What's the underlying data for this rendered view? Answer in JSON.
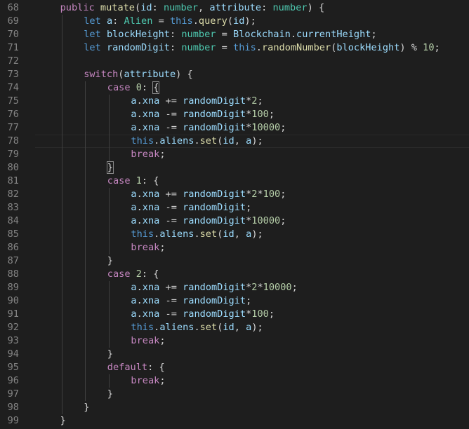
{
  "editor": {
    "theme": {
      "background": "#1e1e1e",
      "line_number": "#858585",
      "keyword": "#c586c0",
      "this": "#569cd6",
      "function": "#dcdcaa",
      "variable": "#9cdcfe",
      "type": "#4ec9b0",
      "number": "#b5cea8",
      "plain": "#d4d4d4"
    },
    "current_line": "78",
    "lines": [
      {
        "num": "68",
        "indent": 1,
        "tokens": [
          [
            "kw",
            "public"
          ],
          [
            "plain",
            " "
          ],
          [
            "fn",
            "mutate"
          ],
          [
            "plain",
            "("
          ],
          [
            "var",
            "id"
          ],
          [
            "plain",
            ": "
          ],
          [
            "type",
            "number"
          ],
          [
            "plain",
            ", "
          ],
          [
            "var",
            "attribute"
          ],
          [
            "plain",
            ": "
          ],
          [
            "type",
            "number"
          ],
          [
            "plain",
            ") {"
          ]
        ]
      },
      {
        "num": "69",
        "indent": 2,
        "tokens": [
          [
            "this",
            "let"
          ],
          [
            "plain",
            " "
          ],
          [
            "var",
            "a"
          ],
          [
            "plain",
            ": "
          ],
          [
            "type",
            "Alien"
          ],
          [
            "plain",
            " = "
          ],
          [
            "this",
            "this"
          ],
          [
            "plain",
            "."
          ],
          [
            "fn",
            "query"
          ],
          [
            "plain",
            "("
          ],
          [
            "var",
            "id"
          ],
          [
            "plain",
            ");"
          ]
        ]
      },
      {
        "num": "70",
        "indent": 2,
        "tokens": [
          [
            "this",
            "let"
          ],
          [
            "plain",
            " "
          ],
          [
            "var",
            "blockHeight"
          ],
          [
            "plain",
            ": "
          ],
          [
            "type",
            "number"
          ],
          [
            "plain",
            " = "
          ],
          [
            "var",
            "Blockchain"
          ],
          [
            "plain",
            "."
          ],
          [
            "var",
            "currentHeight"
          ],
          [
            "plain",
            ";"
          ]
        ]
      },
      {
        "num": "71",
        "indent": 2,
        "tokens": [
          [
            "this",
            "let"
          ],
          [
            "plain",
            " "
          ],
          [
            "var",
            "randomDigit"
          ],
          [
            "plain",
            ": "
          ],
          [
            "type",
            "number"
          ],
          [
            "plain",
            " = "
          ],
          [
            "this",
            "this"
          ],
          [
            "plain",
            "."
          ],
          [
            "fn",
            "randomNumber"
          ],
          [
            "plain",
            "("
          ],
          [
            "var",
            "blockHeight"
          ],
          [
            "plain",
            ") % "
          ],
          [
            "num",
            "10"
          ],
          [
            "plain",
            ";"
          ]
        ]
      },
      {
        "num": "72",
        "indent": 0,
        "tokens": []
      },
      {
        "num": "73",
        "indent": 2,
        "tokens": [
          [
            "kw",
            "switch"
          ],
          [
            "plain",
            "("
          ],
          [
            "var",
            "attribute"
          ],
          [
            "plain",
            ") {"
          ]
        ]
      },
      {
        "num": "74",
        "indent": 3,
        "tokens": [
          [
            "kw",
            "case"
          ],
          [
            "plain",
            " "
          ],
          [
            "num",
            "0"
          ],
          [
            "plain",
            ": "
          ],
          [
            "hl",
            "{"
          ]
        ]
      },
      {
        "num": "75",
        "indent": 4,
        "tokens": [
          [
            "var",
            "a"
          ],
          [
            "plain",
            "."
          ],
          [
            "var",
            "xna"
          ],
          [
            "plain",
            " += "
          ],
          [
            "var",
            "randomDigit"
          ],
          [
            "plain",
            "*"
          ],
          [
            "num",
            "2"
          ],
          [
            "plain",
            ";"
          ]
        ]
      },
      {
        "num": "76",
        "indent": 4,
        "tokens": [
          [
            "var",
            "a"
          ],
          [
            "plain",
            "."
          ],
          [
            "var",
            "xna"
          ],
          [
            "plain",
            " -= "
          ],
          [
            "var",
            "randomDigit"
          ],
          [
            "plain",
            "*"
          ],
          [
            "num",
            "100"
          ],
          [
            "plain",
            ";"
          ]
        ]
      },
      {
        "num": "77",
        "indent": 4,
        "tokens": [
          [
            "var",
            "a"
          ],
          [
            "plain",
            "."
          ],
          [
            "var",
            "xna"
          ],
          [
            "plain",
            " -= "
          ],
          [
            "var",
            "randomDigit"
          ],
          [
            "plain",
            "*"
          ],
          [
            "num",
            "10000"
          ],
          [
            "plain",
            ";"
          ]
        ]
      },
      {
        "num": "78",
        "indent": 4,
        "tokens": [
          [
            "this",
            "this"
          ],
          [
            "plain",
            "."
          ],
          [
            "var",
            "aliens"
          ],
          [
            "plain",
            "."
          ],
          [
            "fn",
            "set"
          ],
          [
            "plain",
            "("
          ],
          [
            "var",
            "id"
          ],
          [
            "plain",
            ", "
          ],
          [
            "var",
            "a"
          ],
          [
            "plain",
            ");"
          ]
        ]
      },
      {
        "num": "79",
        "indent": 4,
        "tokens": [
          [
            "kw",
            "break"
          ],
          [
            "plain",
            ";"
          ]
        ]
      },
      {
        "num": "80",
        "indent": 3,
        "tokens": [
          [
            "hl",
            "}"
          ]
        ]
      },
      {
        "num": "81",
        "indent": 3,
        "tokens": [
          [
            "kw",
            "case"
          ],
          [
            "plain",
            " "
          ],
          [
            "num",
            "1"
          ],
          [
            "plain",
            ": {"
          ]
        ]
      },
      {
        "num": "82",
        "indent": 4,
        "tokens": [
          [
            "var",
            "a"
          ],
          [
            "plain",
            "."
          ],
          [
            "var",
            "xna"
          ],
          [
            "plain",
            " += "
          ],
          [
            "var",
            "randomDigit"
          ],
          [
            "plain",
            "*"
          ],
          [
            "num",
            "2"
          ],
          [
            "plain",
            "*"
          ],
          [
            "num",
            "100"
          ],
          [
            "plain",
            ";"
          ]
        ]
      },
      {
        "num": "83",
        "indent": 4,
        "tokens": [
          [
            "var",
            "a"
          ],
          [
            "plain",
            "."
          ],
          [
            "var",
            "xna"
          ],
          [
            "plain",
            " -= "
          ],
          [
            "var",
            "randomDigit"
          ],
          [
            "plain",
            ";"
          ]
        ]
      },
      {
        "num": "84",
        "indent": 4,
        "tokens": [
          [
            "var",
            "a"
          ],
          [
            "plain",
            "."
          ],
          [
            "var",
            "xna"
          ],
          [
            "plain",
            " -= "
          ],
          [
            "var",
            "randomDigit"
          ],
          [
            "plain",
            "*"
          ],
          [
            "num",
            "10000"
          ],
          [
            "plain",
            ";"
          ]
        ]
      },
      {
        "num": "85",
        "indent": 4,
        "tokens": [
          [
            "this",
            "this"
          ],
          [
            "plain",
            "."
          ],
          [
            "var",
            "aliens"
          ],
          [
            "plain",
            "."
          ],
          [
            "fn",
            "set"
          ],
          [
            "plain",
            "("
          ],
          [
            "var",
            "id"
          ],
          [
            "plain",
            ", "
          ],
          [
            "var",
            "a"
          ],
          [
            "plain",
            ");"
          ]
        ]
      },
      {
        "num": "86",
        "indent": 4,
        "tokens": [
          [
            "kw",
            "break"
          ],
          [
            "plain",
            ";"
          ]
        ]
      },
      {
        "num": "87",
        "indent": 3,
        "tokens": [
          [
            "plain",
            "}"
          ]
        ]
      },
      {
        "num": "88",
        "indent": 3,
        "tokens": [
          [
            "kw",
            "case"
          ],
          [
            "plain",
            " "
          ],
          [
            "num",
            "2"
          ],
          [
            "plain",
            ": {"
          ]
        ]
      },
      {
        "num": "89",
        "indent": 4,
        "tokens": [
          [
            "var",
            "a"
          ],
          [
            "plain",
            "."
          ],
          [
            "var",
            "xna"
          ],
          [
            "plain",
            " += "
          ],
          [
            "var",
            "randomDigit"
          ],
          [
            "plain",
            "*"
          ],
          [
            "num",
            "2"
          ],
          [
            "plain",
            "*"
          ],
          [
            "num",
            "10000"
          ],
          [
            "plain",
            ";"
          ]
        ]
      },
      {
        "num": "90",
        "indent": 4,
        "tokens": [
          [
            "var",
            "a"
          ],
          [
            "plain",
            "."
          ],
          [
            "var",
            "xna"
          ],
          [
            "plain",
            " -= "
          ],
          [
            "var",
            "randomDigit"
          ],
          [
            "plain",
            ";"
          ]
        ]
      },
      {
        "num": "91",
        "indent": 4,
        "tokens": [
          [
            "var",
            "a"
          ],
          [
            "plain",
            "."
          ],
          [
            "var",
            "xna"
          ],
          [
            "plain",
            " -= "
          ],
          [
            "var",
            "randomDigit"
          ],
          [
            "plain",
            "*"
          ],
          [
            "num",
            "100"
          ],
          [
            "plain",
            ";"
          ]
        ]
      },
      {
        "num": "92",
        "indent": 4,
        "tokens": [
          [
            "this",
            "this"
          ],
          [
            "plain",
            "."
          ],
          [
            "var",
            "aliens"
          ],
          [
            "plain",
            "."
          ],
          [
            "fn",
            "set"
          ],
          [
            "plain",
            "("
          ],
          [
            "var",
            "id"
          ],
          [
            "plain",
            ", "
          ],
          [
            "var",
            "a"
          ],
          [
            "plain",
            ");"
          ]
        ]
      },
      {
        "num": "93",
        "indent": 4,
        "tokens": [
          [
            "kw",
            "break"
          ],
          [
            "plain",
            ";"
          ]
        ]
      },
      {
        "num": "94",
        "indent": 3,
        "tokens": [
          [
            "plain",
            "}"
          ]
        ]
      },
      {
        "num": "95",
        "indent": 3,
        "tokens": [
          [
            "kw",
            "default"
          ],
          [
            "plain",
            ": {"
          ]
        ]
      },
      {
        "num": "96",
        "indent": 4,
        "tokens": [
          [
            "kw",
            "break"
          ],
          [
            "plain",
            ";"
          ]
        ]
      },
      {
        "num": "97",
        "indent": 3,
        "tokens": [
          [
            "plain",
            "}"
          ]
        ]
      },
      {
        "num": "98",
        "indent": 2,
        "tokens": [
          [
            "plain",
            "}"
          ]
        ]
      },
      {
        "num": "99",
        "indent": 1,
        "tokens": [
          [
            "plain",
            "}"
          ]
        ]
      }
    ]
  }
}
